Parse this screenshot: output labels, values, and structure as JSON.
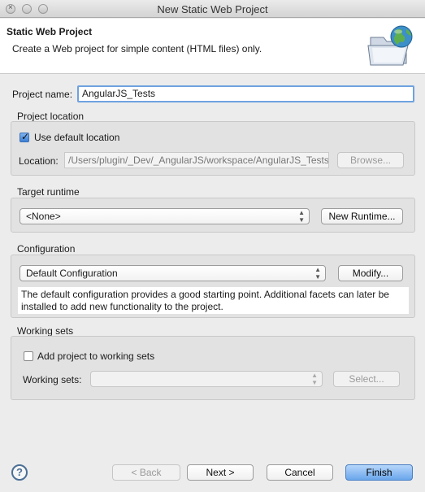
{
  "window": {
    "title": "New Static Web Project"
  },
  "header": {
    "title": "Static Web Project",
    "description": "Create a Web project for simple content (HTML files) only."
  },
  "project_name": {
    "label": "Project name:",
    "value": "AngularJS_Tests"
  },
  "project_location": {
    "group_label": "Project location",
    "use_default_label": "Use default location",
    "use_default_checked": true,
    "location_label": "Location:",
    "location_value": "/Users/plugin/_Dev/_AngularJS/workspace/AngularJS_Tests",
    "browse_label": "Browse..."
  },
  "target_runtime": {
    "group_label": "Target runtime",
    "selected": "<None>",
    "new_runtime_label": "New Runtime..."
  },
  "configuration": {
    "group_label": "Configuration",
    "selected": "Default Configuration",
    "modify_label": "Modify...",
    "description": "The default configuration provides a good starting point. Additional facets can later be installed to add new functionality to the project."
  },
  "working_sets": {
    "group_label": "Working sets",
    "add_label": "Add project to working sets",
    "add_checked": false,
    "working_sets_label": "Working sets:",
    "selected": "",
    "select_label": "Select..."
  },
  "footer": {
    "help_label": "?",
    "back_label": "< Back",
    "next_label": "Next >",
    "cancel_label": "Cancel",
    "finish_label": "Finish"
  }
}
